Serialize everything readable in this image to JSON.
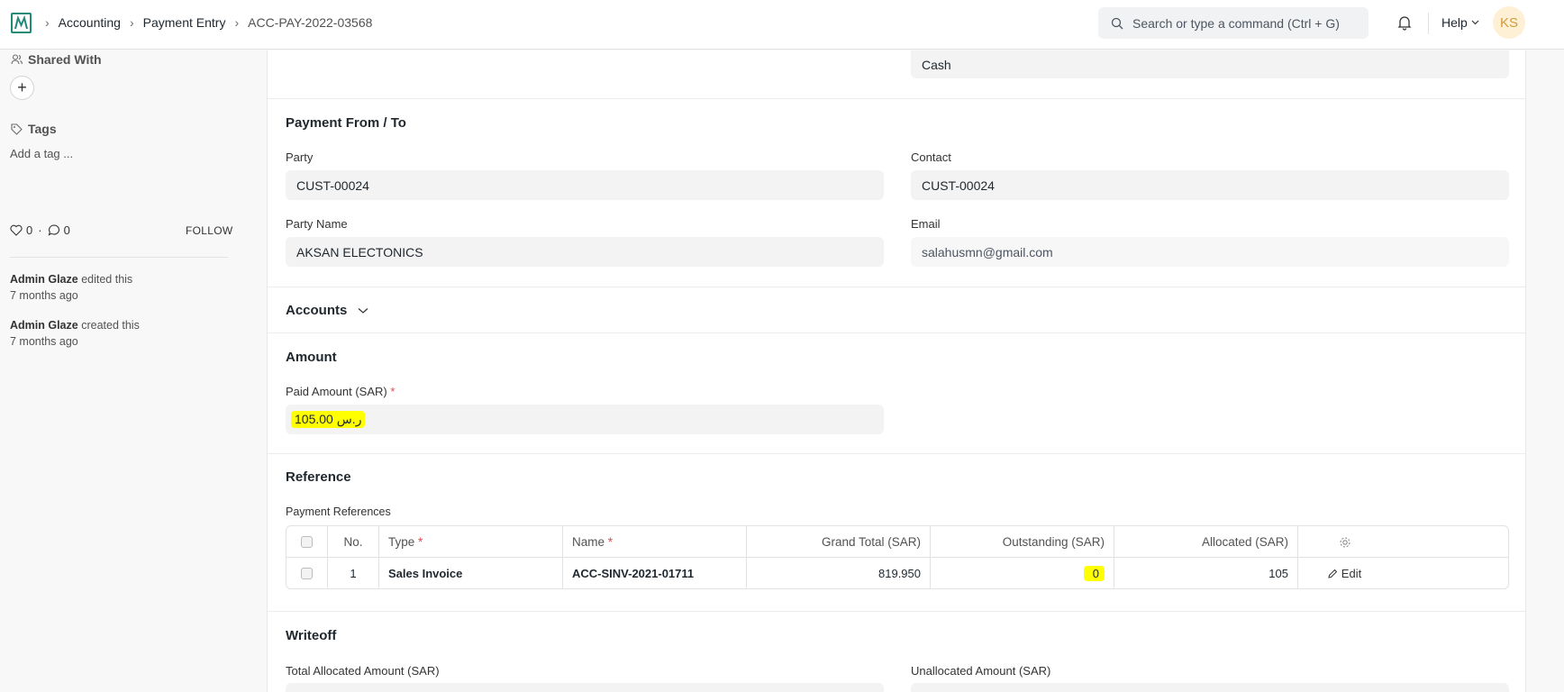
{
  "navbar": {
    "breadcrumbs": [
      "Accounting",
      "Payment Entry",
      "ACC-PAY-2022-03568"
    ],
    "search_placeholder": "Search or type a command (Ctrl + G)",
    "help_label": "Help",
    "avatar_initials": "KS"
  },
  "sidebar": {
    "shared_with_label": "Shared With",
    "tags_label": "Tags",
    "add_tag_label": "Add a tag ...",
    "likes": "0",
    "comments": "0",
    "dot": "·",
    "follow_label": "FOLLOW",
    "activity": [
      {
        "user": "Admin Glaze",
        "action": "edited this",
        "time": "7 months ago"
      },
      {
        "user": "Admin Glaze",
        "action": "created this",
        "time": "7 months ago"
      }
    ]
  },
  "form": {
    "mode_of_payment_value": "Cash",
    "payment_from_to": {
      "title": "Payment From / To",
      "party_label": "Party",
      "party_value": "CUST-00024",
      "contact_label": "Contact",
      "contact_value": "CUST-00024",
      "party_name_label": "Party Name",
      "party_name_value": "AKSAN ELECTONICS",
      "email_label": "Email",
      "email_value": "salahusmn@gmail.com"
    },
    "accounts_title": "Accounts",
    "amount": {
      "title": "Amount",
      "paid_amount_label": "Paid Amount (SAR)",
      "required_mark": "*",
      "paid_amount_value": "105.00 ر.س"
    },
    "reference": {
      "title": "Reference",
      "table_label": "Payment References",
      "columns": [
        "No.",
        "Type",
        "Name",
        "Grand Total (SAR)",
        "Outstanding (SAR)",
        "Allocated (SAR)"
      ],
      "rows": [
        {
          "no": "1",
          "type": "Sales Invoice",
          "name": "ACC-SINV-2021-01711",
          "grand_total": "819.950",
          "outstanding": "0",
          "allocated": "105",
          "edit_label": "Edit"
        }
      ]
    },
    "writeoff": {
      "title": "Writeoff",
      "total_allocated_label": "Total Allocated Amount (SAR)",
      "unallocated_label": "Unallocated Amount (SAR)"
    }
  },
  "colors": {
    "highlight": "#ffff00",
    "required": "#e24c4c",
    "brand": "#1f8a78"
  }
}
